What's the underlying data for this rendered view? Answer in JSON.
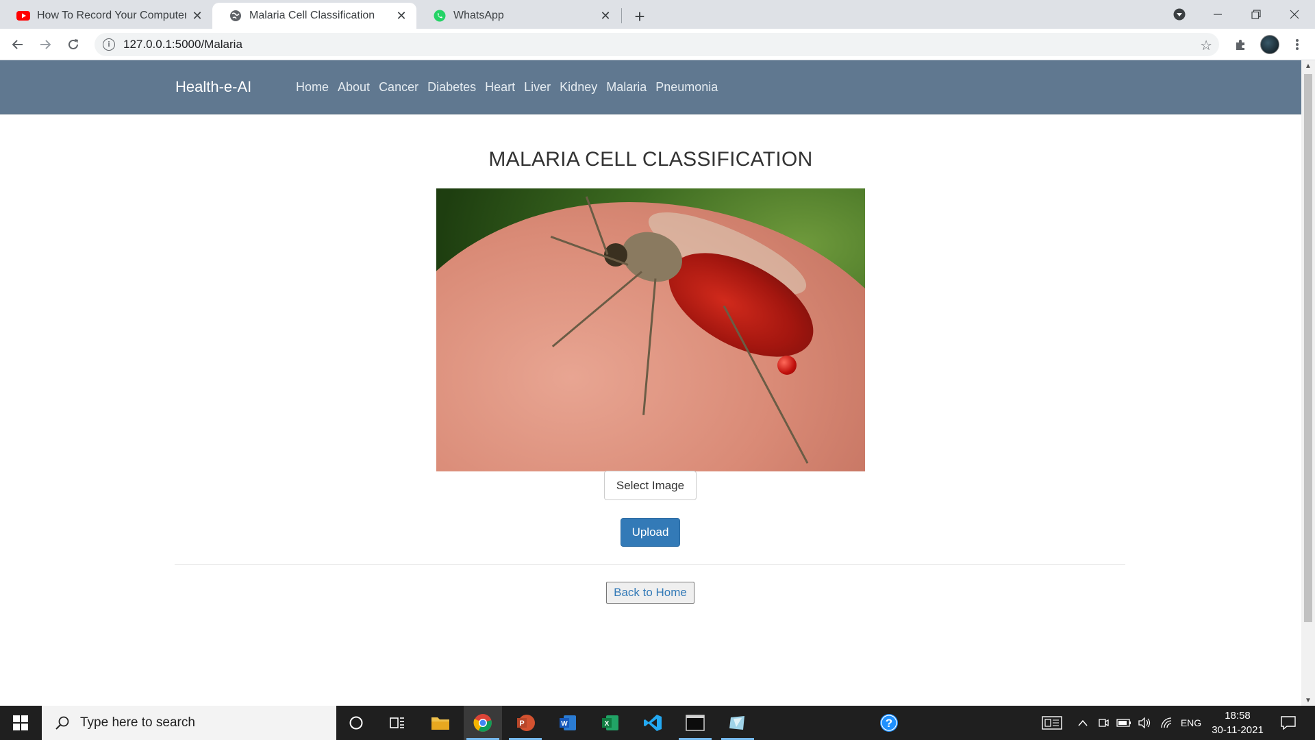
{
  "browser": {
    "tabs": [
      {
        "title": "How To Record Your Computer S",
        "icon": "youtube-icon",
        "active": false
      },
      {
        "title": "Malaria Cell Classification",
        "icon": "globe-icon",
        "active": true
      },
      {
        "title": "WhatsApp",
        "icon": "whatsapp-icon",
        "active": false
      }
    ],
    "new_tab_label": "+",
    "url": "127.0.0.1:5000/Malaria"
  },
  "navbar": {
    "brand": "Health-e-AI",
    "links": [
      "Home",
      "About",
      "Cancer",
      "Diabetes",
      "Heart",
      "Liver",
      "Kidney",
      "Malaria",
      "Pneumonia"
    ]
  },
  "main": {
    "title": "MALARIA CELL CLASSIFICATION",
    "hero_image": "mosquito-feeding-photo",
    "select_button": "Select Image",
    "upload_button": "Upload",
    "back_button": "Back to Home"
  },
  "taskbar": {
    "search_placeholder": "Type here to search",
    "language": "ENG",
    "time": "18:58",
    "date": "30-11-2021"
  },
  "colors": {
    "navbar": "#607890",
    "primary": "#337ab7",
    "taskbar": "#1f1f1f"
  }
}
